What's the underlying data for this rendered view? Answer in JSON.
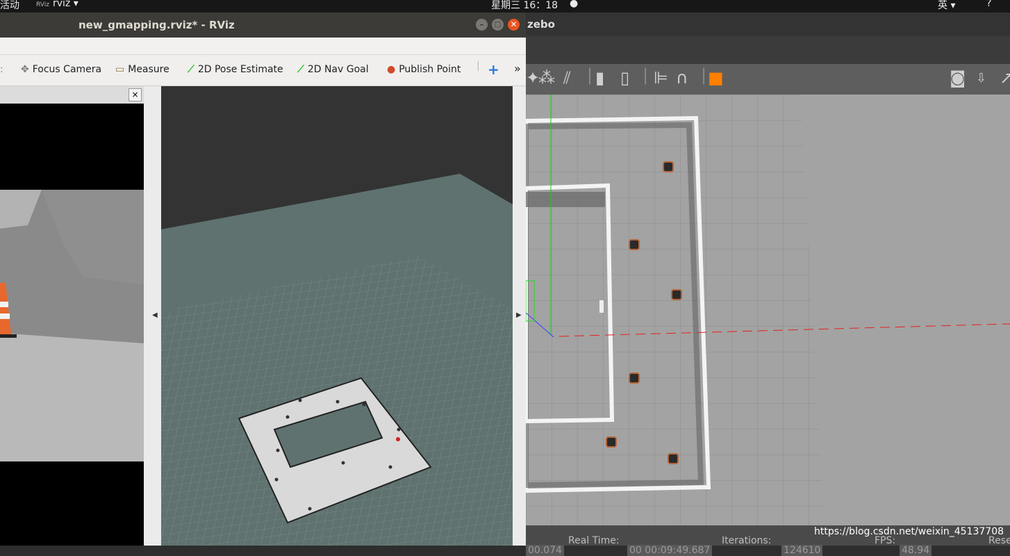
{
  "topbar": {
    "activities": "活动",
    "app_icon": "rviz-icon",
    "app_name": "rviz",
    "clock": "星期三 16：18",
    "input_method": "英",
    "help": "?"
  },
  "rviz": {
    "title": "new_gmapping.rviz* - RViz",
    "tools": [
      {
        "icon": "focus-camera-icon",
        "label": "Focus Camera"
      },
      {
        "icon": "measure-icon",
        "label": "Measure"
      },
      {
        "icon": "pose-estimate-icon",
        "label": "2D Pose Estimate"
      },
      {
        "icon": "nav-goal-icon",
        "label": "2D Nav Goal"
      },
      {
        "icon": "publish-point-icon",
        "label": "Publish Point"
      }
    ],
    "overflow": "»",
    "add": "+",
    "close": "×"
  },
  "gazebo": {
    "title_fragment": "zebo",
    "status": {
      "sim_time_fragment": "00.074",
      "real_time_label": "Real Time:",
      "real_time_value": "00 00:09:49.687",
      "iterations_label": "Iterations:",
      "iterations_value": "124610",
      "fps_label": "FPS:",
      "fps_value": "48.94",
      "reset_fragment": "Rese"
    }
  },
  "watermark": "https://blog.csdn.net/weixin_45137708",
  "colors": {
    "rviz_title_bg": "#3c3b37",
    "close_btn": "#e95420",
    "grid_floor": "#5f7270",
    "gazebo_bg": "#a3a3a3"
  }
}
